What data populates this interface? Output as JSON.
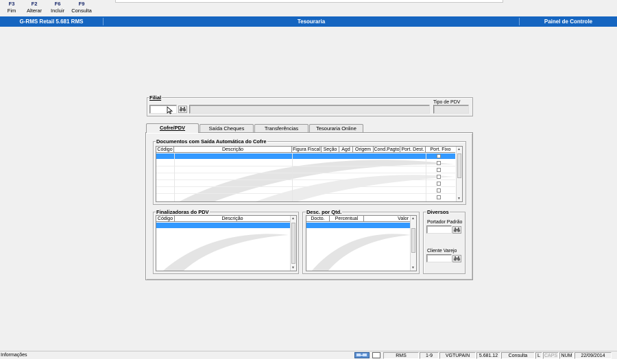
{
  "fkeys": [
    {
      "key": "F3",
      "label": "Fim"
    },
    {
      "key": "F2",
      "label": "Alterar"
    },
    {
      "key": "F6",
      "label": "Incluir"
    },
    {
      "key": "F9",
      "label": "Consulta"
    }
  ],
  "titlebar": {
    "app": "G-RMS Retail 5.681 RMS",
    "module": "Tesouraria",
    "control": "Painel de Controle"
  },
  "filial": {
    "label": "Filial",
    "code_value": "",
    "name_value": "",
    "tipo_pdv_label": "Tipo de PDV",
    "tipo_pdv_value": ""
  },
  "tabs": [
    {
      "label": "Cofre/PDV",
      "active": true
    },
    {
      "label": "Saída Cheques",
      "active": false
    },
    {
      "label": "Transferências",
      "active": false
    },
    {
      "label": "Tesouraria Online",
      "active": false
    }
  ],
  "documentos": {
    "title": "Documentos com Saída Automática do Cofre",
    "columns": [
      "Código",
      "Descrição",
      "Figura Fiscal",
      "Seção",
      "Agd",
      "Origem",
      "Cond.Pagto",
      "Port. Dest.",
      "Port. Fixo"
    ]
  },
  "finalizadoras": {
    "title": "Finalizadoras do PDV",
    "columns": [
      "Código",
      "Descrição"
    ]
  },
  "desc_qtd": {
    "title": "Desc. por Qtd.",
    "columns": [
      "Docto.",
      "Percentual",
      "Valor"
    ]
  },
  "diversos": {
    "title": "Diversos",
    "portador_label": "Portador Padrão",
    "portador_value": "",
    "cliente_label": "Cliente Varejo",
    "cliente_value": ""
  },
  "status": {
    "info": "Informações",
    "system": "RMS",
    "range": "1-9",
    "program": "VGTUPAIN",
    "version": "5.681.12",
    "mode": "Consulta",
    "l": "L",
    "caps": "CAPS",
    "num": "NUM",
    "date": "22/09/2014"
  }
}
